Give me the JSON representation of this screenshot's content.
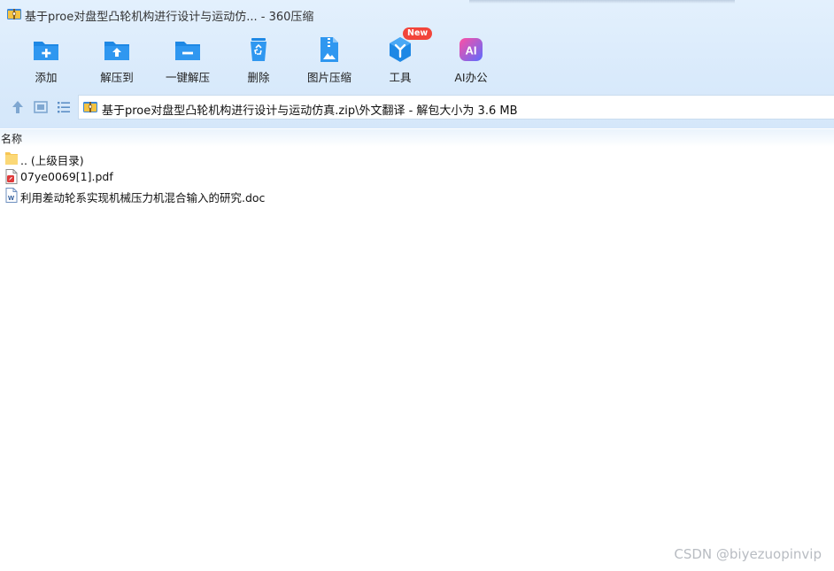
{
  "window": {
    "title": "基于proe对盘型凸轮机构进行设计与运动仿...  - 360压缩"
  },
  "toolbar": {
    "items": [
      {
        "label": "添加",
        "icon": "add-folder-icon"
      },
      {
        "label": "解压到",
        "icon": "extract-to-icon"
      },
      {
        "label": "一键解压",
        "icon": "one-click-extract-icon"
      },
      {
        "label": "删除",
        "icon": "recycle-bin-icon"
      },
      {
        "label": "图片压缩",
        "icon": "image-compress-icon"
      },
      {
        "label": "工具",
        "icon": "tools-icon",
        "badge": "New"
      },
      {
        "label": "AI办公",
        "icon": "ai-office-icon",
        "icon_text": "AI"
      }
    ]
  },
  "nav": {
    "path": "基于proe对盘型凸轮机构进行设计与运动仿真.zip\\外文翻译 - 解包大小为 3.6 MB"
  },
  "list": {
    "header_name": "名称",
    "rows": [
      {
        "name": ".. (上级目录)",
        "icon": "folder-icon"
      },
      {
        "name": "07ye0069[1].pdf",
        "icon": "pdf-file-icon"
      },
      {
        "name": "利用差动轮系实现机械压力机混合输入的研究.doc",
        "icon": "word-file-icon"
      }
    ]
  },
  "watermark": "CSDN @biyezuopinvip",
  "colors": {
    "toolbar_blue": "#1e88e5",
    "badge_red": "#f2443a",
    "ai_gradient_start": "#ff4fa3",
    "ai_gradient_end": "#5b6cff"
  }
}
